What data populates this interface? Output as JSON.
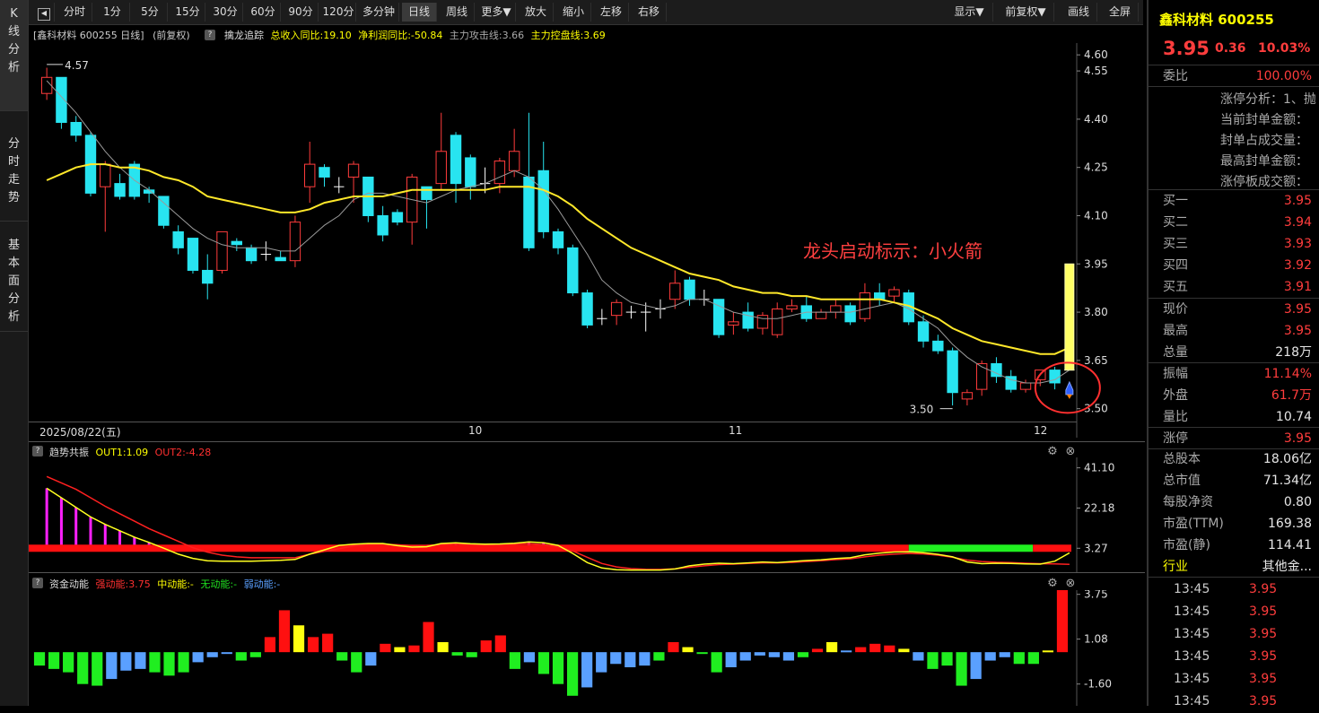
{
  "vtabs": {
    "kline": "K线分析",
    "fenshi": "分时走势",
    "jiben": "基本面分析"
  },
  "toolbar": {
    "buttons": [
      "分时",
      "1分",
      "5分",
      "15分",
      "30分",
      "60分",
      "90分",
      "120分",
      "多分钟",
      "日线",
      "周线",
      "更多▼",
      "放大",
      "缩小",
      "左移",
      "右移"
    ],
    "active": "日线",
    "right": [
      "显示▼",
      "前复权▼",
      "画线",
      "全屏"
    ]
  },
  "main_header": {
    "stock": "[鑫科材料 600255 日线]",
    "adj": "(前复权)",
    "help": "?",
    "indicator": "擒龙追踪",
    "items": [
      {
        "label": "总收入同比:19.10",
        "color": "#ffff00"
      },
      {
        "label": "净利润同比:-50.84",
        "color": "#ffff00"
      },
      {
        "label": "主力攻击线:3.66",
        "color": "#aaaaaa"
      },
      {
        "label": "主力控盘线:3.69",
        "color": "#ffff00"
      }
    ]
  },
  "annotation": {
    "text": "龙头启动标示：小火箭",
    "max_label": "4.57",
    "min_label": "3.50",
    "rocket": "rocket-icon"
  },
  "date_axis": {
    "start": "2025/08/22(五)",
    "months": [
      "10",
      "11",
      "12"
    ]
  },
  "panel2": {
    "name": "趋势共振",
    "out1": "OUT1:1.09",
    "out2": "OUT2:-4.28",
    "ticks": [
      "41.10",
      "22.18",
      "3.27"
    ]
  },
  "panel3": {
    "name": "资金动能",
    "strong": "强动能:3.75",
    "mid": "中动能:-",
    "none": "无动能:-",
    "weak": "弱动能:-",
    "ticks": [
      "3.75",
      "1.08",
      "-1.60"
    ]
  },
  "chart_data": [
    {
      "type": "candlestick",
      "name": "price",
      "y_ticks": [
        4.6,
        4.55,
        4.4,
        4.25,
        4.1,
        3.95,
        3.8,
        3.65,
        3.5
      ],
      "ylim": [
        3.46,
        4.62
      ],
      "candles": [
        [
          4.48,
          4.53,
          4.46,
          4.56
        ],
        [
          4.53,
          4.39,
          4.37,
          4.53
        ],
        [
          4.39,
          4.35,
          4.33,
          4.41
        ],
        [
          4.35,
          4.17,
          4.16,
          4.36
        ],
        [
          4.19,
          4.26,
          4.05,
          4.27
        ],
        [
          4.2,
          4.16,
          4.15,
          4.23
        ],
        [
          4.26,
          4.16,
          4.15,
          4.27
        ],
        [
          4.18,
          4.17,
          4.14,
          4.19
        ],
        [
          4.16,
          4.07,
          4.06,
          4.16
        ],
        [
          4.05,
          4.0,
          3.98,
          4.07
        ],
        [
          4.03,
          3.93,
          3.92,
          4.03
        ],
        [
          3.93,
          3.89,
          3.84,
          3.98
        ],
        [
          3.93,
          4.05,
          3.92,
          4.05
        ],
        [
          4.02,
          4.01,
          3.99,
          4.03
        ],
        [
          4.0,
          3.96,
          3.95,
          4.01
        ],
        [
          3.98,
          3.98,
          3.96,
          4.02
        ],
        [
          3.97,
          3.96,
          3.96,
          3.99
        ],
        [
          3.96,
          4.08,
          3.94,
          4.1
        ],
        [
          4.19,
          4.26,
          4.14,
          4.33
        ],
        [
          4.25,
          4.22,
          4.19,
          4.26
        ],
        [
          4.19,
          4.19,
          4.17,
          4.22
        ],
        [
          4.22,
          4.26,
          4.14,
          4.27
        ],
        [
          4.22,
          4.1,
          4.08,
          4.22
        ],
        [
          4.1,
          4.04,
          4.02,
          4.13
        ],
        [
          4.11,
          4.08,
          4.07,
          4.12
        ],
        [
          4.08,
          4.22,
          4.01,
          4.23
        ],
        [
          4.19,
          4.15,
          4.06,
          4.19
        ],
        [
          4.2,
          4.3,
          4.18,
          4.42
        ],
        [
          4.35,
          4.2,
          4.14,
          4.36
        ],
        [
          4.28,
          4.19,
          4.15,
          4.29
        ],
        [
          4.2,
          4.2,
          4.17,
          4.25
        ],
        [
          4.2,
          4.27,
          4.17,
          4.28
        ],
        [
          4.24,
          4.3,
          4.22,
          4.37
        ],
        [
          4.22,
          4.0,
          3.99,
          4.42
        ],
        [
          4.24,
          4.05,
          4.03,
          4.33
        ],
        [
          4.05,
          4.0,
          3.98,
          4.06
        ],
        [
          4.0,
          3.86,
          3.85,
          4.01
        ],
        [
          3.86,
          3.76,
          3.75,
          3.87
        ],
        [
          3.78,
          3.78,
          3.76,
          3.81
        ],
        [
          3.79,
          3.83,
          3.76,
          3.84
        ],
        [
          3.8,
          3.8,
          3.78,
          3.82
        ],
        [
          3.8,
          3.8,
          3.74,
          3.83
        ],
        [
          3.81,
          3.81,
          3.78,
          3.84
        ],
        [
          3.84,
          3.89,
          3.81,
          3.93
        ],
        [
          3.9,
          3.84,
          3.82,
          3.91
        ],
        [
          3.84,
          3.84,
          3.82,
          3.87
        ],
        [
          3.84,
          3.73,
          3.72,
          3.84
        ],
        [
          3.76,
          3.77,
          3.73,
          3.8
        ],
        [
          3.8,
          3.75,
          3.74,
          3.83
        ],
        [
          3.75,
          3.79,
          3.73,
          3.8
        ],
        [
          3.73,
          3.81,
          3.72,
          3.83
        ],
        [
          3.81,
          3.82,
          3.8,
          3.84
        ],
        [
          3.82,
          3.78,
          3.77,
          3.85
        ],
        [
          3.78,
          3.8,
          3.78,
          3.81
        ],
        [
          3.8,
          3.82,
          3.78,
          3.84
        ],
        [
          3.82,
          3.77,
          3.76,
          3.83
        ],
        [
          3.78,
          3.86,
          3.77,
          3.89
        ],
        [
          3.86,
          3.84,
          3.82,
          3.89
        ],
        [
          3.85,
          3.87,
          3.83,
          3.88
        ],
        [
          3.86,
          3.77,
          3.76,
          3.87
        ],
        [
          3.77,
          3.71,
          3.69,
          3.79
        ],
        [
          3.71,
          3.68,
          3.67,
          3.73
        ],
        [
          3.68,
          3.55,
          3.51,
          3.69
        ],
        [
          3.53,
          3.55,
          3.51,
          3.56
        ],
        [
          3.56,
          3.64,
          3.54,
          3.65
        ],
        [
          3.64,
          3.6,
          3.58,
          3.66
        ],
        [
          3.6,
          3.56,
          3.55,
          3.62
        ],
        [
          3.56,
          3.58,
          3.55,
          3.59
        ],
        [
          3.59,
          3.62,
          3.57,
          3.62
        ],
        [
          3.62,
          3.58,
          3.56,
          3.63
        ],
        [
          3.62,
          3.62,
          3.62,
          3.62
        ]
      ],
      "ma_yellow": [
        4.21,
        4.23,
        4.25,
        4.26,
        4.26,
        4.25,
        4.25,
        4.24,
        4.22,
        4.21,
        4.19,
        4.16,
        4.15,
        4.14,
        4.13,
        4.12,
        4.11,
        4.11,
        4.12,
        4.14,
        4.15,
        4.16,
        4.16,
        4.16,
        4.17,
        4.18,
        4.18,
        4.18,
        4.18,
        4.18,
        4.18,
        4.19,
        4.19,
        4.19,
        4.18,
        4.16,
        4.13,
        4.09,
        4.06,
        4.03,
        4.0,
        3.98,
        3.96,
        3.94,
        3.92,
        3.91,
        3.9,
        3.88,
        3.87,
        3.86,
        3.86,
        3.85,
        3.85,
        3.84,
        3.84,
        3.84,
        3.84,
        3.84,
        3.83,
        3.82,
        3.8,
        3.78,
        3.75,
        3.73,
        3.71,
        3.7,
        3.69,
        3.68,
        3.67,
        3.67,
        3.69
      ],
      "ma_gray": [
        4.52,
        4.47,
        4.42,
        4.36,
        4.3,
        4.25,
        4.21,
        4.18,
        4.14,
        4.1,
        4.06,
        4.03,
        4.01,
        4.0,
        4.0,
        4.0,
        3.99,
        3.99,
        4.03,
        4.07,
        4.1,
        4.15,
        4.17,
        4.17,
        4.16,
        4.15,
        4.14,
        4.16,
        4.18,
        4.19,
        4.2,
        4.22,
        4.24,
        4.22,
        4.18,
        4.12,
        4.05,
        3.98,
        3.9,
        3.86,
        3.83,
        3.82,
        3.81,
        3.82,
        3.84,
        3.84,
        3.82,
        3.8,
        3.79,
        3.78,
        3.78,
        3.79,
        3.8,
        3.8,
        3.8,
        3.8,
        3.81,
        3.82,
        3.83,
        3.81,
        3.78,
        3.75,
        3.7,
        3.66,
        3.63,
        3.61,
        3.59,
        3.58,
        3.58,
        3.59,
        3.62
      ],
      "rocket_bar": {
        "from": 3.62,
        "to": 3.95
      }
    },
    {
      "type": "line",
      "name": "趋势共振",
      "out1": [
        31.5,
        27,
        22.5,
        18,
        14.5,
        11.5,
        8.5,
        6,
        3.3,
        0.5,
        -1.5,
        -2.6,
        -2.8,
        -2.8,
        -2.8,
        -2.6,
        -2.4,
        -2.0,
        0.5,
        2.5,
        4.6,
        5.2,
        5.5,
        5.5,
        4.5,
        3.8,
        4.0,
        5.5,
        5.8,
        5.4,
        5.2,
        5.3,
        5.6,
        6.2,
        5.9,
        4.6,
        0.8,
        -3.5,
        -6,
        -6.8,
        -7,
        -7,
        -7,
        -6.5,
        -5.0,
        -4.2,
        -3.8,
        -4.0,
        -3.6,
        -3.2,
        -3.5,
        -3.0,
        -2.5,
        -2.2,
        -1.6,
        -1.2,
        0.2,
        1.0,
        1.5,
        1.6,
        1.2,
        0.4,
        -0.8,
        -3.2,
        -4.0,
        -3.8,
        -3.9,
        -4.1,
        -4.2,
        -2.8,
        1.09
      ],
      "out2": [
        37,
        34,
        31,
        27,
        23,
        19.5,
        16,
        12.5,
        9.5,
        6.5,
        3.5,
        1.4,
        0,
        -0.8,
        -1.2,
        -1.2,
        -1.2,
        -1.2,
        0.5,
        1.8,
        3.0,
        4.4,
        5.0,
        5.2,
        4.9,
        4.5,
        4.6,
        5.0,
        5.3,
        5.0,
        4.9,
        5.0,
        5.2,
        5.4,
        5.0,
        4.0,
        2.0,
        -1.0,
        -3.9,
        -5.5,
        -6.3,
        -6.6,
        -6.7,
        -6.4,
        -5.7,
        -5.0,
        -4.4,
        -4.2,
        -3.9,
        -3.6,
        -3.6,
        -3.4,
        -3.0,
        -2.6,
        -2.1,
        -1.7,
        -0.8,
        0.0,
        0.5,
        0.8,
        0.6,
        0.0,
        -1.0,
        -2.3,
        -3.0,
        -3.3,
        -3.5,
        -3.8,
        -4.0,
        -4.1,
        -4.28
      ],
      "ylim": [
        -8,
        46
      ]
    },
    {
      "type": "bar",
      "name": "资金动能",
      "values": [
        -0.8,
        -1.0,
        -1.2,
        -1.9,
        -2.0,
        -1.6,
        -1.1,
        -1.0,
        -1.2,
        -1.4,
        -1.2,
        -0.6,
        -0.3,
        -0.1,
        -0.5,
        -0.3,
        0.9,
        2.5,
        1.6,
        0.9,
        1.1,
        -0.5,
        -1.2,
        -0.8,
        0.5,
        0.3,
        0.4,
        1.8,
        0.6,
        -0.2,
        -0.3,
        0.7,
        1.0,
        -1.0,
        -0.6,
        -1.3,
        -1.9,
        -2.6,
        -2.1,
        -1.2,
        -0.7,
        -0.9,
        -0.8,
        -0.5,
        0.6,
        0.3,
        -0.1,
        -1.2,
        -0.9,
        -0.5,
        -0.2,
        -0.3,
        -0.5,
        -0.3,
        0.2,
        0.6,
        0.1,
        0.3,
        0.5,
        0.4,
        0.2,
        -0.5,
        -1.0,
        -0.8,
        -2.0,
        -1.6,
        -0.5,
        -0.3,
        -0.7,
        -0.7,
        0.1,
        3.75
      ],
      "colors": [
        "g",
        "g",
        "g",
        "g",
        "g",
        "b",
        "b",
        "b",
        "g",
        "g",
        "g",
        "b",
        "b",
        "b",
        "g",
        "g",
        "r",
        "r",
        "y",
        "r",
        "r",
        "g",
        "g",
        "b",
        "r",
        "y",
        "r",
        "r",
        "y",
        "g",
        "g",
        "r",
        "r",
        "g",
        "b",
        "g",
        "g",
        "g",
        "b",
        "b",
        "b",
        "b",
        "b",
        "g",
        "r",
        "y",
        "g",
        "g",
        "b",
        "b",
        "b",
        "b",
        "b",
        "g",
        "r",
        "y",
        "b",
        "r",
        "r",
        "r",
        "y",
        "b",
        "g",
        "g",
        "g",
        "b",
        "b",
        "b",
        "g",
        "g",
        "y",
        "r"
      ],
      "ylim": [
        -2.9,
        4.0
      ]
    }
  ],
  "right_panel": {
    "title": "鑫科材料 600255",
    "price": "3.95",
    "change": "0.36",
    "pct": "10.03%",
    "weibi_label": "委比",
    "weibi_value": "100.00%",
    "limit_rows": [
      "涨停分析：1、抛",
      "当前封单金额：",
      "封单占成交量：",
      "最高封单金额：",
      "涨停板成交额："
    ],
    "buys": [
      {
        "l": "买一",
        "v": "3.95"
      },
      {
        "l": "买二",
        "v": "3.94"
      },
      {
        "l": "买三",
        "v": "3.93"
      },
      {
        "l": "买四",
        "v": "3.92"
      },
      {
        "l": "买五",
        "v": "3.91"
      }
    ],
    "quote": [
      {
        "l": "现价",
        "v": "3.95",
        "c": "red"
      },
      {
        "l": "最高",
        "v": "3.95",
        "c": "red"
      },
      {
        "l": "总量",
        "v": "218万",
        "c": "white"
      }
    ],
    "stats": [
      {
        "l": "振幅",
        "v": "11.14%",
        "c": "red"
      },
      {
        "l": "外盘",
        "v": "61.7万",
        "c": "red"
      },
      {
        "l": "量比",
        "v": "10.74",
        "c": "white"
      }
    ],
    "zt": {
      "l": "涨停",
      "v": "3.95"
    },
    "fund": [
      {
        "l": "总股本",
        "v": "18.06亿"
      },
      {
        "l": "总市值",
        "v": "71.34亿"
      },
      {
        "l": "每股净资",
        "v": "0.80"
      },
      {
        "l": "市盈(TTM)",
        "v": "169.38"
      },
      {
        "l": "市盈(静)",
        "v": "114.41"
      }
    ],
    "industry": {
      "l": "行业",
      "v": "其他金..."
    },
    "ticks": [
      {
        "t": "13:45",
        "p": "3.95"
      },
      {
        "t": "13:45",
        "p": "3.95"
      },
      {
        "t": "13:45",
        "p": "3.95"
      },
      {
        "t": "13:45",
        "p": "3.95"
      },
      {
        "t": "13:45",
        "p": "3.95"
      },
      {
        "t": "13:45",
        "p": "3.95"
      }
    ]
  }
}
